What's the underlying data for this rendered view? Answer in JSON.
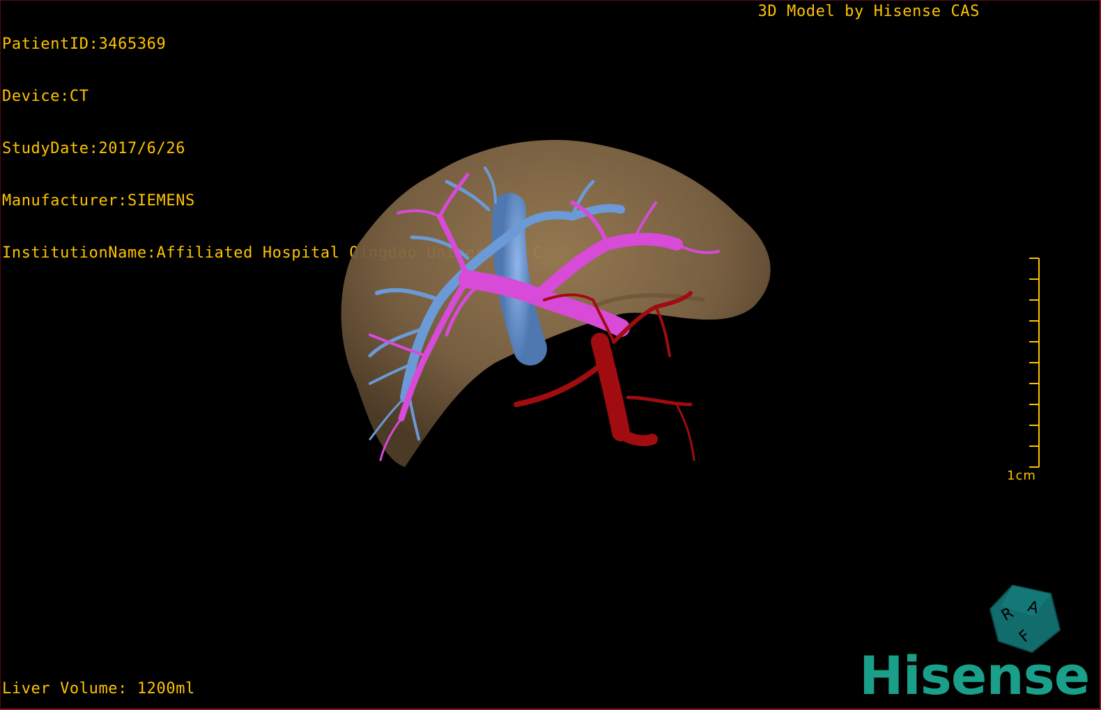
{
  "overlay": {
    "patient_id": "PatientID:3465369",
    "device": "Device:CT",
    "study_date": "StudyDate:2017/6/26",
    "manufacturer": "Manufacturer:SIEMENS",
    "institution": "InstitutionName:Affiliated Hospital Qingdao University-C",
    "credit": "3D Model by Hisense CAS",
    "liver_volume": "Liver Volume: 1200ml"
  },
  "scale": {
    "label": "1cm"
  },
  "orientation_cube": {
    "letters": [
      "R",
      "A",
      "F"
    ]
  },
  "brand": {
    "logo_text": "Hisense"
  },
  "colors": {
    "text": "#ffc400",
    "liver": "#8a6f4a",
    "portal_vein": "#d84ad8",
    "hepatic_vein": "#6b9ad6",
    "artery": "#a00c10",
    "cube": "#126c6c",
    "logo": "#1aa08a",
    "frame": "#8a1622"
  }
}
